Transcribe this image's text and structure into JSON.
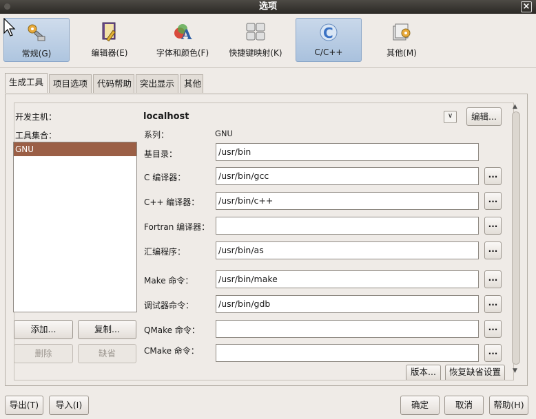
{
  "window": {
    "title": "选项",
    "close_glyph": "×"
  },
  "toolbar": {
    "items": [
      {
        "label": "常规(G)",
        "icon": "general-settings-icon"
      },
      {
        "label": "编辑器(E)",
        "icon": "editor-icon"
      },
      {
        "label": "字体和颜色(F)",
        "icon": "fonts-colors-icon"
      },
      {
        "label": "快捷键映射(K)",
        "icon": "keymap-icon"
      },
      {
        "label": "C/C++",
        "icon": "cpp-icon",
        "selected": true
      },
      {
        "label": "其他(M)",
        "icon": "misc-icon"
      }
    ]
  },
  "tabs": [
    {
      "label": "生成工具",
      "active": true
    },
    {
      "label": "项目选项"
    },
    {
      "label": "代码帮助"
    },
    {
      "label": "突出显示"
    },
    {
      "label": "其他"
    }
  ],
  "build": {
    "host_label": "开发主机：",
    "host_value": "localhost",
    "host_edit_button": "编辑...",
    "toolset_label": "工具集合：",
    "toolsets": [
      "GNU"
    ],
    "family_label": "系列：",
    "family_value": "GNU",
    "fields": [
      {
        "label": "基目录：",
        "value": "/usr/bin",
        "browse": false
      },
      {
        "label": "C 编译器：",
        "value": "/usr/bin/gcc",
        "browse": true
      },
      {
        "label": "C++ 编译器：",
        "value": "/usr/bin/c++",
        "browse": true
      },
      {
        "label": "Fortran 编译器：",
        "value": "",
        "browse": true
      },
      {
        "label": "汇编程序：",
        "value": "/usr/bin/as",
        "browse": true
      },
      {
        "label": "Make 命令：",
        "value": "/usr/bin/make",
        "browse": true
      },
      {
        "label": "调试器命令：",
        "value": "/usr/bin/gdb",
        "browse": true
      },
      {
        "label": "QMake 命令：",
        "value": "",
        "browse": true
      },
      {
        "label": "CMake 命令：",
        "value": "",
        "browse": true
      }
    ],
    "browse_label": "...",
    "add_button": "添加...",
    "copy_button": "复制...",
    "delete_button": "删除",
    "default_button": "缺省",
    "versions_button": "版本...",
    "restore_button": "恢复缺省设置"
  },
  "footer": {
    "export_button": "导出(T)",
    "import_button": "导入(I)",
    "ok_button": "确定",
    "cancel_button": "取消",
    "help_button": "帮助(H)"
  }
}
